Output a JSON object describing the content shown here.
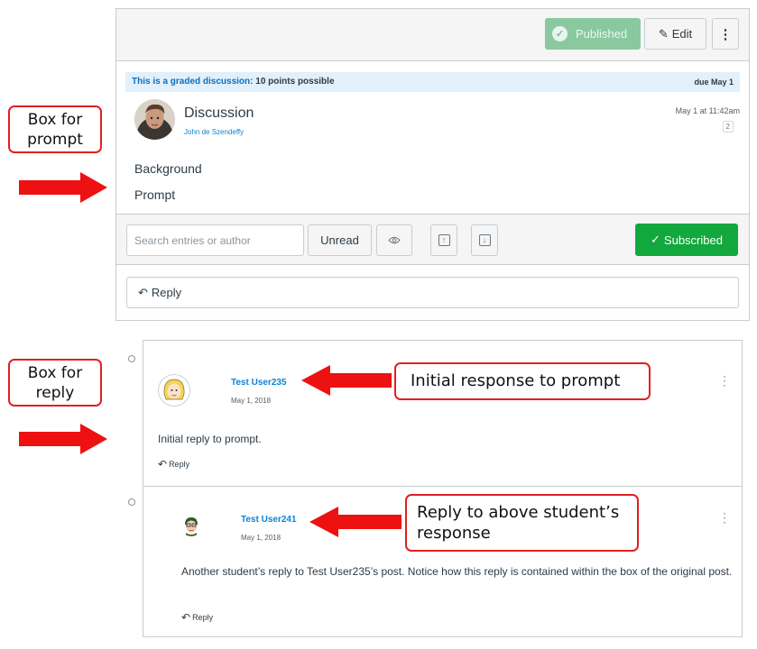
{
  "callouts": {
    "prompt_box": "Box for prompt",
    "reply_box": "Box for reply",
    "initial_response": "Initial response to prompt",
    "reply_above": "Reply to above student’s response"
  },
  "colors": {
    "callout_border": "#e02020",
    "arrow": "#ee1111",
    "accent_link": "#0b84d6",
    "subscribed": "#13a83d",
    "published": "#8ac99f"
  },
  "header": {
    "published_label": "Published",
    "edit_label": "Edit",
    "more_icon": "kebab-icon"
  },
  "discussion": {
    "graded_label": "This is a graded discussion:",
    "points": "10 points possible",
    "due": "due May 1",
    "title": "Discussion",
    "author": "John de Szendeffy",
    "date": "May 1 at 11:42am",
    "reply_count": "2",
    "body_lines": [
      "Background",
      "Prompt"
    ]
  },
  "toolbar": {
    "search_placeholder": "Search entries or author",
    "unread_label": "Unread",
    "subscribed_label": "Subscribed"
  },
  "reply_bar": {
    "label": "Reply"
  },
  "entries": [
    {
      "user": "Test User235",
      "date": "May 1, 2018",
      "body": "Initial reply to prompt.",
      "reply_label": "Reply"
    },
    {
      "user": "Test User241",
      "date": "May 1, 2018",
      "body": "Another student’s reply to Test User235’s post. Notice how this reply is contained within the box of the original post.",
      "reply_label": "Reply"
    }
  ]
}
